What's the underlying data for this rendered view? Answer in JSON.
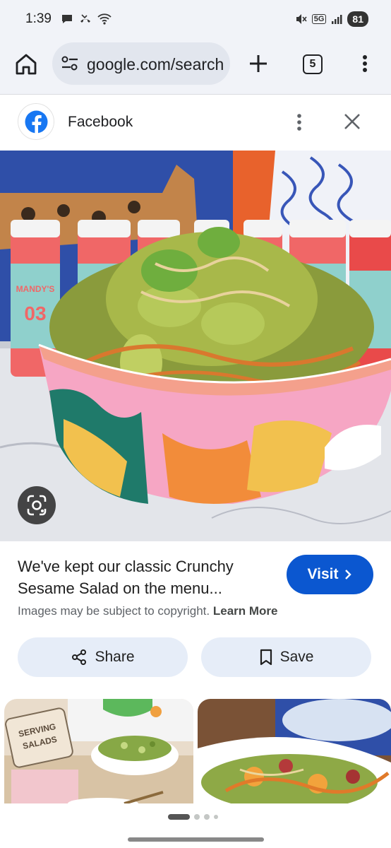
{
  "status_bar": {
    "time": "1:39",
    "network": "5G",
    "battery": "81"
  },
  "browser": {
    "url": "google.com/search",
    "tab_count": "5"
  },
  "source": {
    "name": "Facebook"
  },
  "result": {
    "title": "We've kept our classic Crunchy Sesame Salad on the menu...",
    "visit_label": "Visit",
    "copyright_text": "Images may be subject to copyright.",
    "learn_more": "Learn More",
    "share_label": "Share",
    "save_label": "Save"
  },
  "image_text": {
    "bottle_brand": "MANDY'S",
    "bottle_number": "03",
    "sign_line1": "SERVING",
    "sign_line2": "SALADS"
  },
  "colors": {
    "accent": "#0b57d0",
    "chip_bg": "#e6edf8",
    "facebook_blue": "#1877f2"
  }
}
